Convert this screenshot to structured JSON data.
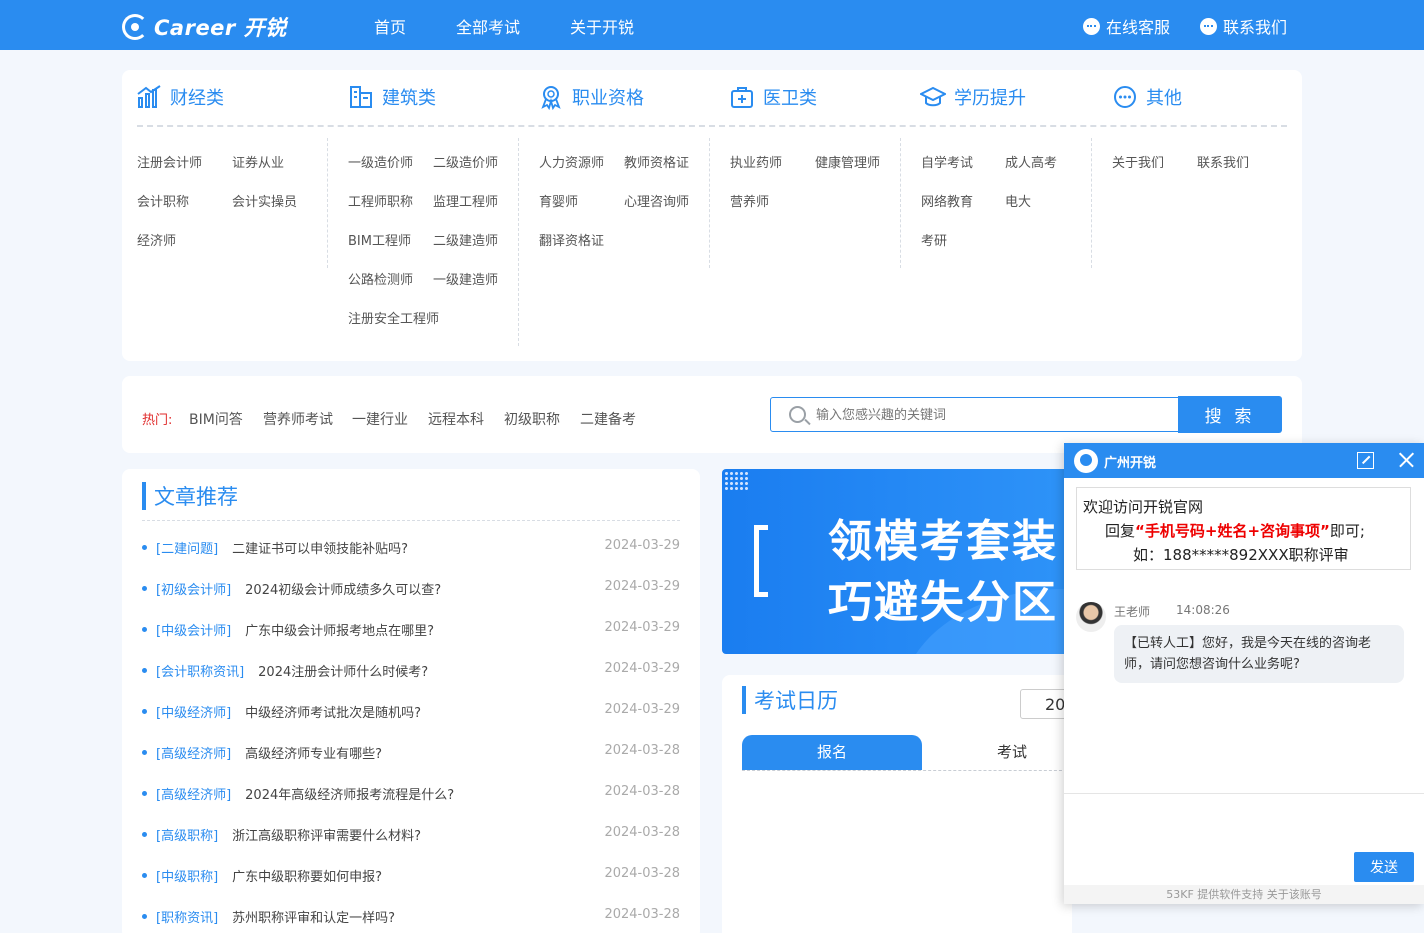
{
  "nav": {
    "logo_text": "Career 开锐",
    "links": [
      "首页",
      "全部考试",
      "关于开锐"
    ],
    "service": "在线客服",
    "contact": "联系我们"
  },
  "categories": [
    {
      "title": "财经类",
      "icon": "chart-bar-icon",
      "items": [
        "注册会计师",
        "证券从业",
        "会计职称",
        "会计实操员",
        "经济师"
      ]
    },
    {
      "title": "建筑类",
      "icon": "building-icon",
      "items": [
        "一级造价师",
        "二级造价师",
        "工程师职称",
        "监理工程师",
        "BIM工程师",
        "二级建造师",
        "公路检测师",
        "一级建造师",
        "注册安全工程师"
      ]
    },
    {
      "title": "职业资格",
      "icon": "award-icon",
      "items": [
        "人力资源师",
        "教师资格证",
        "育婴师",
        "心理咨询师",
        "翻译资格证"
      ]
    },
    {
      "title": "医卫类",
      "icon": "medical-kit-icon",
      "items": [
        "执业药师",
        "健康管理师",
        "营养师"
      ]
    },
    {
      "title": "学历提升",
      "icon": "graduation-cap-icon",
      "items": [
        "自学考试",
        "成人高考",
        "网络教育",
        "电大",
        "考研"
      ]
    },
    {
      "title": "其他",
      "icon": "more-dots-icon",
      "items": [
        "关于我们",
        "联系我们"
      ]
    }
  ],
  "hot": {
    "label": "热门:",
    "items": [
      "BIM问答",
      "营养师考试",
      "一建行业",
      "远程本科",
      "初级职称",
      "二建备考"
    ]
  },
  "search": {
    "placeholder": "输入您感兴趣的关键词",
    "button": "搜 索"
  },
  "articles": {
    "title": "文章推荐",
    "items": [
      {
        "tag": "[二建问题]",
        "title": "二建证书可以申领技能补贴吗?",
        "date": "2024-03-29"
      },
      {
        "tag": "[初级会计师]",
        "title": "2024初级会计师成绩多久可以查?",
        "date": "2024-03-29"
      },
      {
        "tag": "[中级会计师]",
        "title": "广东中级会计师报考地点在哪里?",
        "date": "2024-03-29"
      },
      {
        "tag": "[会计职称资讯]",
        "title": "2024注册会计师什么时候考?",
        "date": "2024-03-29"
      },
      {
        "tag": "[中级经济师]",
        "title": "中级经济师考试批次是随机吗?",
        "date": "2024-03-29"
      },
      {
        "tag": "[高级经济师]",
        "title": "高级经济师专业有哪些?",
        "date": "2024-03-28"
      },
      {
        "tag": "[高级经济师]",
        "title": "2024年高级经济师报考流程是什么?",
        "date": "2024-03-28"
      },
      {
        "tag": "[高级职称]",
        "title": "浙江高级职称评审需要什么材料?",
        "date": "2024-03-28"
      },
      {
        "tag": "[中级职称]",
        "title": "广东中级职称要如何申报?",
        "date": "2024-03-28"
      },
      {
        "tag": "[职称资讯]",
        "title": "苏州职称评审和认定一样吗?",
        "date": "2024-03-28"
      }
    ]
  },
  "banner": {
    "line1": "领模考套装",
    "line2": "巧避失分区"
  },
  "calendar": {
    "title": "考试日历",
    "year": "20",
    "tabs": [
      "报名",
      "考试"
    ]
  },
  "chat": {
    "name": "广州开锐",
    "welcome_line1": "欢迎访问开锐官网",
    "welcome_prefix": "回复",
    "welcome_highlight": "“手机号码+姓名+咨询事项”",
    "welcome_suffix": "即可;",
    "welcome_line3": "如：188*****892XXX职称评审",
    "agent_name": "王老师",
    "agent_time": "14:08:26",
    "message": "【已转人工】您好，我是今天在线的咨询老师，请问您想咨询什么业务呢?",
    "send": "发送",
    "footer": "53KF 提供软件支持  关于该账号"
  },
  "colors": {
    "primary": "#2a8cf0",
    "hot_label": "#e02b2b",
    "highlight": "#ee0000"
  }
}
